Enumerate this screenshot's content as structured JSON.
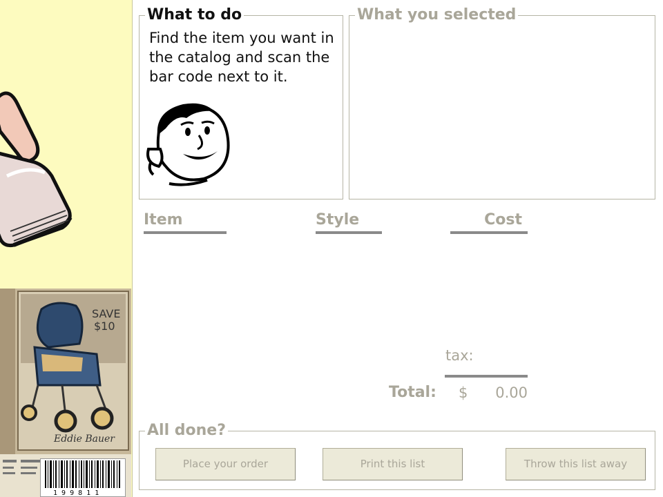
{
  "left_panel": {
    "barcode_digits": "1 9 9 8 1 1",
    "catalog_sign": "SAVE $10",
    "catalog_brand": "Eddie Bauer"
  },
  "what_to_do": {
    "legend": "What to do",
    "instructions": "Find the item you want in the catalog and scan the bar code next to it."
  },
  "what_you_selected": {
    "legend": "What you selected"
  },
  "columns": {
    "item": "Item",
    "style": "Style",
    "cost": "Cost"
  },
  "totals": {
    "tax_label": "tax:",
    "total_label": "Total:",
    "currency": "$",
    "total_value": "0.00"
  },
  "all_done": {
    "legend": "All done?",
    "buttons": {
      "place_order": "Place your order",
      "print_list": "Print this list",
      "throw_away": "Throw this list away"
    }
  },
  "colors": {
    "left_panel_bg": "#fdfbbf",
    "heading_grey": "#a9a699",
    "button_bg": "#ecead9",
    "rule_grey": "#8a8a8a"
  }
}
